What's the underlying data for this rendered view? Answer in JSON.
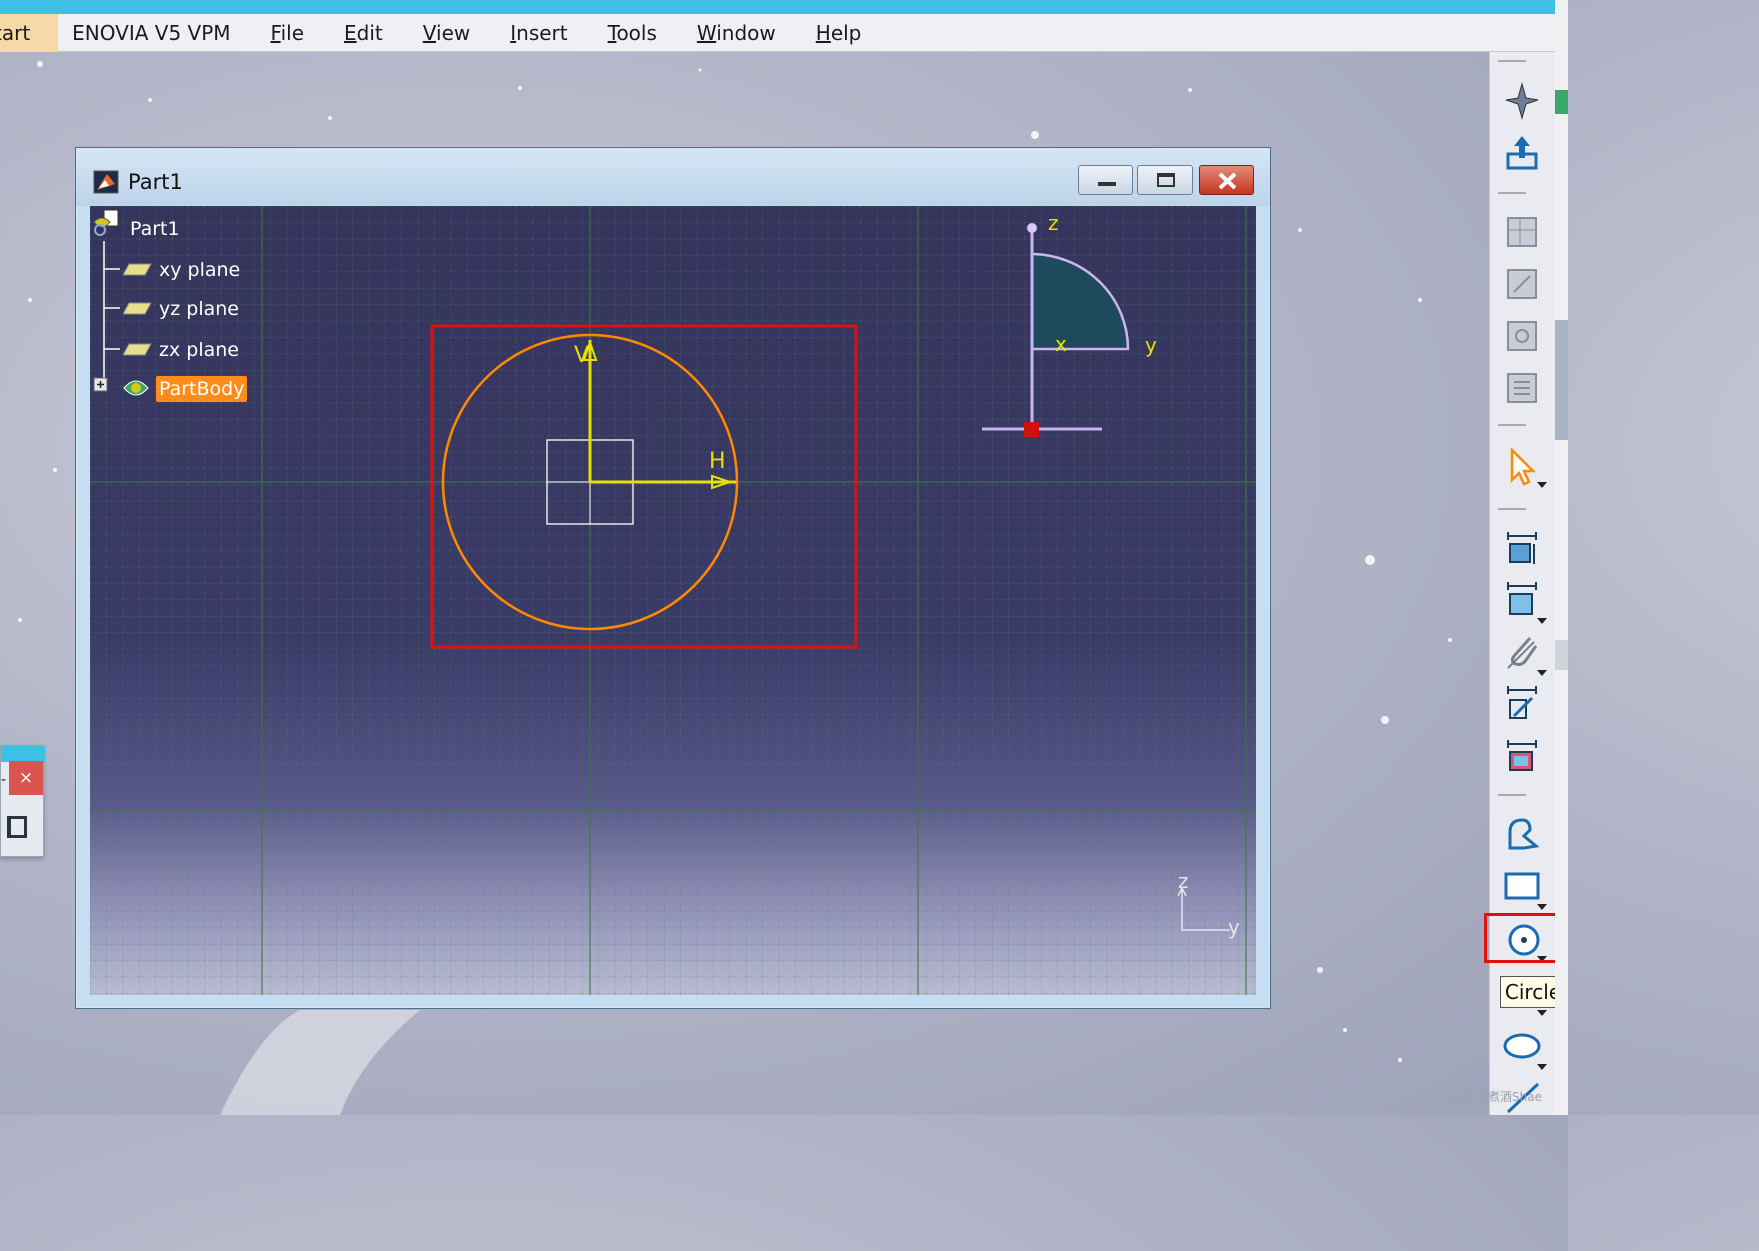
{
  "menubar": {
    "start": "tart",
    "items": [
      {
        "label": "ENOVIA V5 VPM",
        "ul": ""
      },
      {
        "label": "ile",
        "ul": "F"
      },
      {
        "label": "dit",
        "ul": "E"
      },
      {
        "label": "iew",
        "ul": "V"
      },
      {
        "label": "nsert",
        "ul": "I"
      },
      {
        "label": "ools",
        "ul": "T"
      },
      {
        "label": "indow",
        "ul": "W"
      },
      {
        "label": "elp",
        "ul": "H"
      }
    ]
  },
  "window": {
    "title": "Part1",
    "buttons": {
      "minimize": "minimize",
      "maximize": "maximize",
      "close": "close"
    }
  },
  "tree": {
    "root": "Part1",
    "items": [
      "xy plane",
      "yz plane",
      "zx plane"
    ],
    "body": "PartBody"
  },
  "sketch": {
    "h_label": "H",
    "v_label": "V"
  },
  "compass": {
    "z": "z",
    "x": "x",
    "y": "y"
  },
  "axis_corner": {
    "z": "z",
    "y": "y"
  },
  "toolbar": {
    "tooltip": "Circle",
    "buttons": [
      "sketch-icon",
      "exit-icon",
      "icon-a",
      "icon-b",
      "icon-c",
      "icon-d",
      "select-arrow-icon",
      "constraint-icon",
      "constraint-box-icon",
      "clip-icon",
      "fix-icon",
      "animate-icon",
      "profile-icon",
      "rectangle-icon",
      "circle-icon",
      "ellipse-icon",
      "line-icon"
    ]
  },
  "mini_window": {
    "close": "×",
    "dot": "-"
  },
  "watermark": "CSDN @煮酒Shae",
  "colors": {
    "accent_blue": "#3fbfe6",
    "selection_orange": "#ff8c1a",
    "sketch_circle": "#ff8a00",
    "axis_yellow": "#e8e000",
    "highlight_red": "#e01010"
  }
}
